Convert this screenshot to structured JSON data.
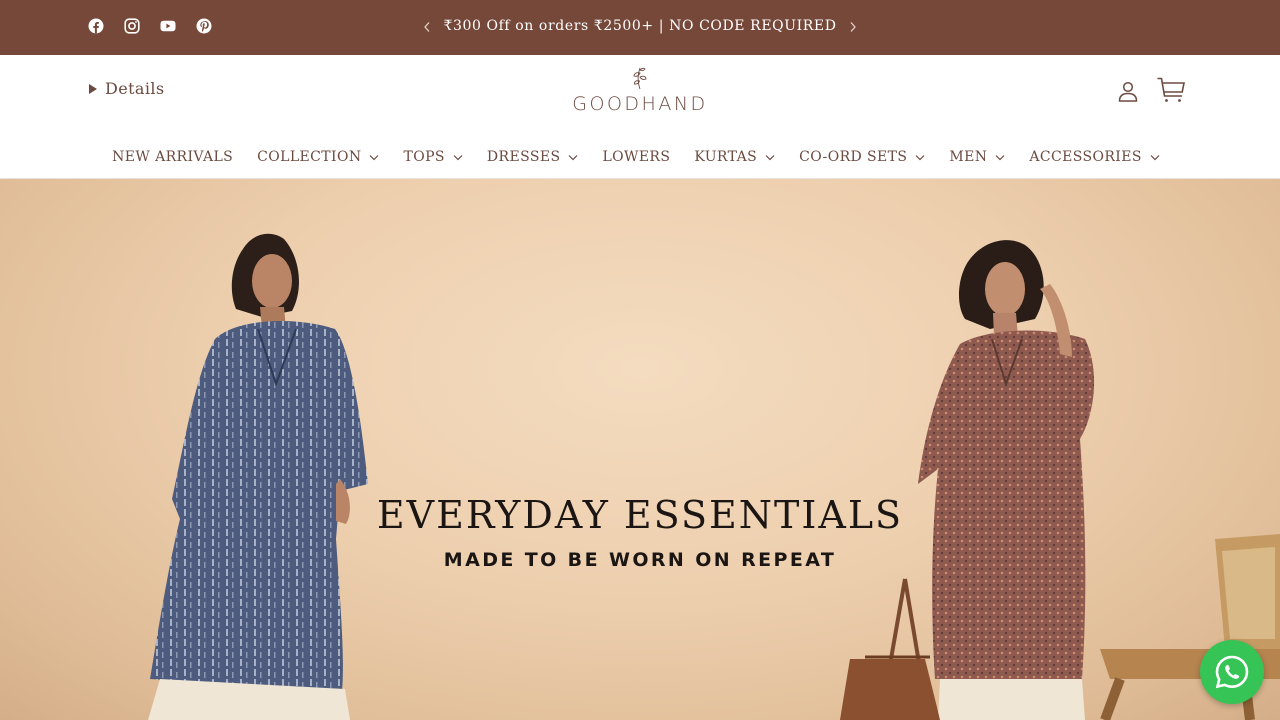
{
  "colors": {
    "topbar": "#754839",
    "text": "#6b4a40",
    "whatsapp": "#36c456"
  },
  "social_icons": [
    "facebook-icon",
    "instagram-icon",
    "youtube-icon",
    "pinterest-icon"
  ],
  "announcement": {
    "text": "₹300 Off on orders ₹2500+ | NO CODE REQUIRED"
  },
  "header": {
    "details_label": "Details",
    "logo_text": "GOODHAND"
  },
  "nav": {
    "items": [
      {
        "label": "NEW ARRIVALS",
        "dropdown": false
      },
      {
        "label": "COLLECTION",
        "dropdown": true
      },
      {
        "label": "TOPS",
        "dropdown": true
      },
      {
        "label": "DRESSES",
        "dropdown": true
      },
      {
        "label": "LOWERS",
        "dropdown": false
      },
      {
        "label": "KURTAS",
        "dropdown": true
      },
      {
        "label": "CO-ORD SETS",
        "dropdown": true
      },
      {
        "label": "MEN",
        "dropdown": true
      },
      {
        "label": "ACCESSORIES",
        "dropdown": true
      }
    ]
  },
  "hero": {
    "title": "EVERYDAY ESSENTIALS",
    "subtitle": "MADE TO BE WORN ON REPEAT"
  }
}
